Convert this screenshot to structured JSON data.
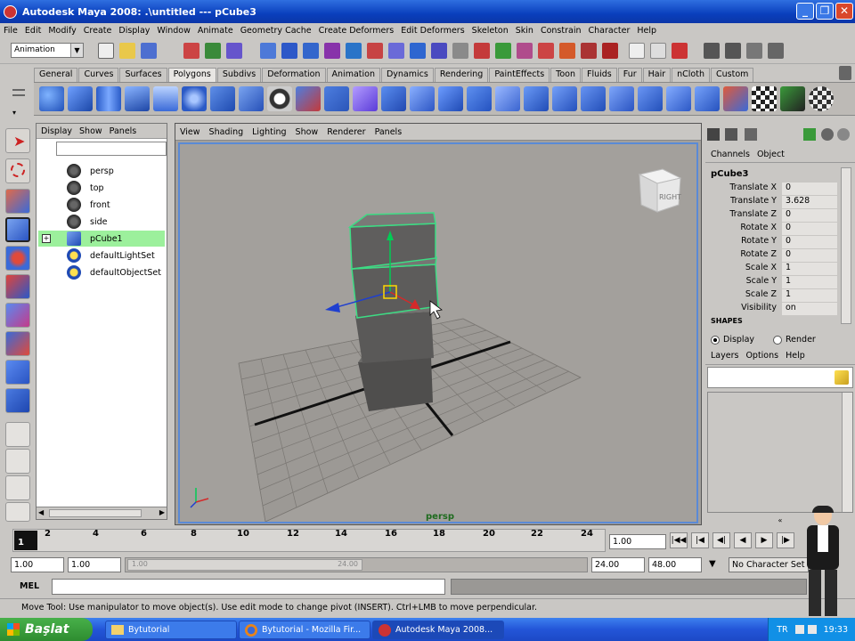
{
  "window": {
    "title": "Autodesk Maya 2008: .\\untitled    ---    pCube3",
    "minimize": "_",
    "maximize": "❐",
    "close": "✕"
  },
  "menubar": [
    "File",
    "Edit",
    "Modify",
    "Create",
    "Display",
    "Window",
    "Animate",
    "Geometry Cache",
    "Create Deformers",
    "Edit Deformers",
    "Skeleton",
    "Skin",
    "Constrain",
    "Character",
    "Help"
  ],
  "mode": "Animation",
  "shelf_tabs": [
    "General",
    "Curves",
    "Surfaces",
    "Polygons",
    "Subdivs",
    "Deformation",
    "Animation",
    "Dynamics",
    "Rendering",
    "PaintEffects",
    "Toon",
    "Fluids",
    "Fur",
    "Hair",
    "nCloth",
    "Custom"
  ],
  "active_shelf_tab": "Polygons",
  "outliner": {
    "menu": [
      "Display",
      "Show",
      "Panels"
    ],
    "items": [
      {
        "label": "persp",
        "icon": "camera-icon"
      },
      {
        "label": "top",
        "icon": "camera-icon"
      },
      {
        "label": "front",
        "icon": "camera-icon"
      },
      {
        "label": "side",
        "icon": "camera-icon"
      },
      {
        "label": "pCube1",
        "icon": "mesh-icon",
        "selected": true
      },
      {
        "label": "defaultLightSet",
        "icon": "set-icon"
      },
      {
        "label": "defaultObjectSet",
        "icon": "set-icon"
      }
    ]
  },
  "viewport": {
    "menu": [
      "View",
      "Shading",
      "Lighting",
      "Show",
      "Renderer",
      "Panels"
    ],
    "camera_label": "persp",
    "viewcube_label": "RIGHT"
  },
  "channelbox": {
    "tabs": [
      "Channels",
      "Object"
    ],
    "object": "pCube3",
    "attributes": [
      {
        "label": "Translate X",
        "value": "0"
      },
      {
        "label": "Translate Y",
        "value": "3.628"
      },
      {
        "label": "Translate Z",
        "value": "0"
      },
      {
        "label": "Rotate X",
        "value": "0"
      },
      {
        "label": "Rotate Y",
        "value": "0"
      },
      {
        "label": "Rotate Z",
        "value": "0"
      },
      {
        "label": "Scale X",
        "value": "1"
      },
      {
        "label": "Scale Y",
        "value": "1"
      },
      {
        "label": "Scale Z",
        "value": "1"
      },
      {
        "label": "Visibility",
        "value": "on"
      }
    ],
    "shapes_label": "SHAPES"
  },
  "layerbox": {
    "display_label": "Display",
    "render_label": "Render",
    "menu": [
      "Layers",
      "Options",
      "Help"
    ]
  },
  "timeline": {
    "ticks": [
      "2",
      "4",
      "6",
      "8",
      "10",
      "12",
      "14",
      "16",
      "18",
      "20",
      "22",
      "24"
    ],
    "current_frame": "1",
    "current_field": "1.00"
  },
  "range": {
    "start": "1.00",
    "playback_start": "1.00",
    "slider_left": "1.00",
    "slider_right": "24.00",
    "playback_end": "24.00",
    "end": "48.00",
    "character_set": "No Character Set"
  },
  "mel_label": "MEL",
  "helpline": "Move Tool: Use manipulator to move object(s). Use edit mode to change pivot (INSERT). Ctrl+LMB to move perpendicular.",
  "taskbar": {
    "start": "Başlat",
    "items": [
      "Bytutorial",
      "Bytutorial",
      "Bytutorial - Mozilla Fir...",
      "Autodesk Maya 2008..."
    ],
    "lang": "TR",
    "time": "19:33"
  },
  "colors": {
    "accent": "#0a3fbd",
    "selection": "#9cf09c",
    "viewport_bg": "#a3a09c",
    "manip_green": "#00ff66",
    "highlight_wire": "#3ddc84"
  }
}
